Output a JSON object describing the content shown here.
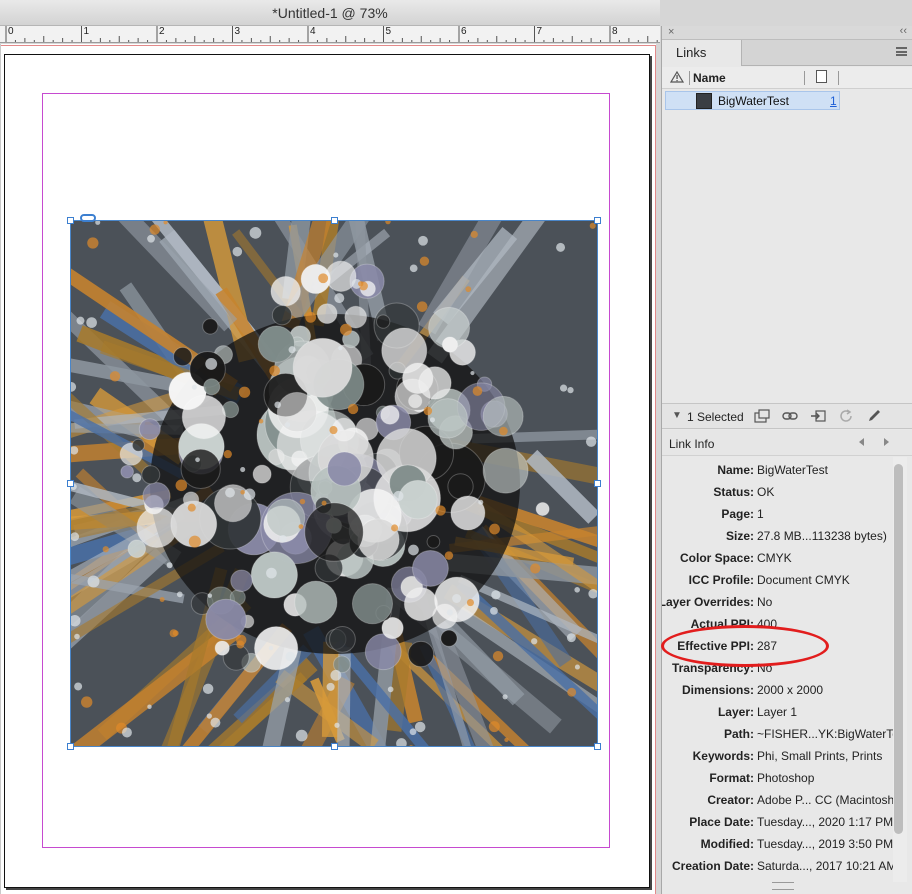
{
  "document": {
    "title": "*Untitled-1 @ 73%",
    "ruler_numbers": [
      "0",
      "1",
      "2",
      "3",
      "4",
      "5",
      "6",
      "7",
      "8"
    ]
  },
  "panel": {
    "tab_label": "Links",
    "close_glyph": "×",
    "collapse_glyph": "‹‹",
    "list_header": {
      "name_label": "Name"
    },
    "selected_row": {
      "name": "BigWaterTest",
      "page": "1"
    },
    "toolbar": {
      "selected_text": "1 Selected"
    },
    "link_info": {
      "title": "Link Info",
      "rows": [
        {
          "label": "Name:",
          "value": "BigWaterTest"
        },
        {
          "label": "Status:",
          "value": "OK"
        },
        {
          "label": "Page:",
          "value": "1"
        },
        {
          "label": "Size:",
          "value": "27.8 MB...113238 bytes)"
        },
        {
          "label": "Color Space:",
          "value": "CMYK"
        },
        {
          "label": "ICC Profile:",
          "value": "Document CMYK"
        },
        {
          "label": "Layer Overrides:",
          "value": "No"
        },
        {
          "label": "Actual PPI:",
          "value": "400"
        },
        {
          "label": "Effective PPI:",
          "value": "287"
        },
        {
          "label": "Transparency:",
          "value": "No"
        },
        {
          "label": "Dimensions:",
          "value": "2000 x 2000"
        },
        {
          "label": "Layer:",
          "value": "Layer 1"
        },
        {
          "label": "Path:",
          "value": "~FISHER...YK:BigWaterTest"
        },
        {
          "label": "Keywords:",
          "value": "Phi, Small Prints, Prints"
        },
        {
          "label": "Format:",
          "value": "Photoshop"
        },
        {
          "label": "Creator:",
          "value": "Adobe P... CC (Macintosh)"
        },
        {
          "label": "Place Date:",
          "value": "Tuesday..., 2020 1:17 PM"
        },
        {
          "label": "Modified:",
          "value": "Tuesday..., 2019 3:50 PM"
        },
        {
          "label": "Creation Date:",
          "value": "Saturda..., 2017 10:21 AM"
        }
      ]
    }
  },
  "colors": {
    "selection": "#cfe0f5",
    "frame": "#4a86c9",
    "margin": "#c64ad0",
    "highlight": "#e21d1d",
    "link": "#1e5fd6"
  }
}
